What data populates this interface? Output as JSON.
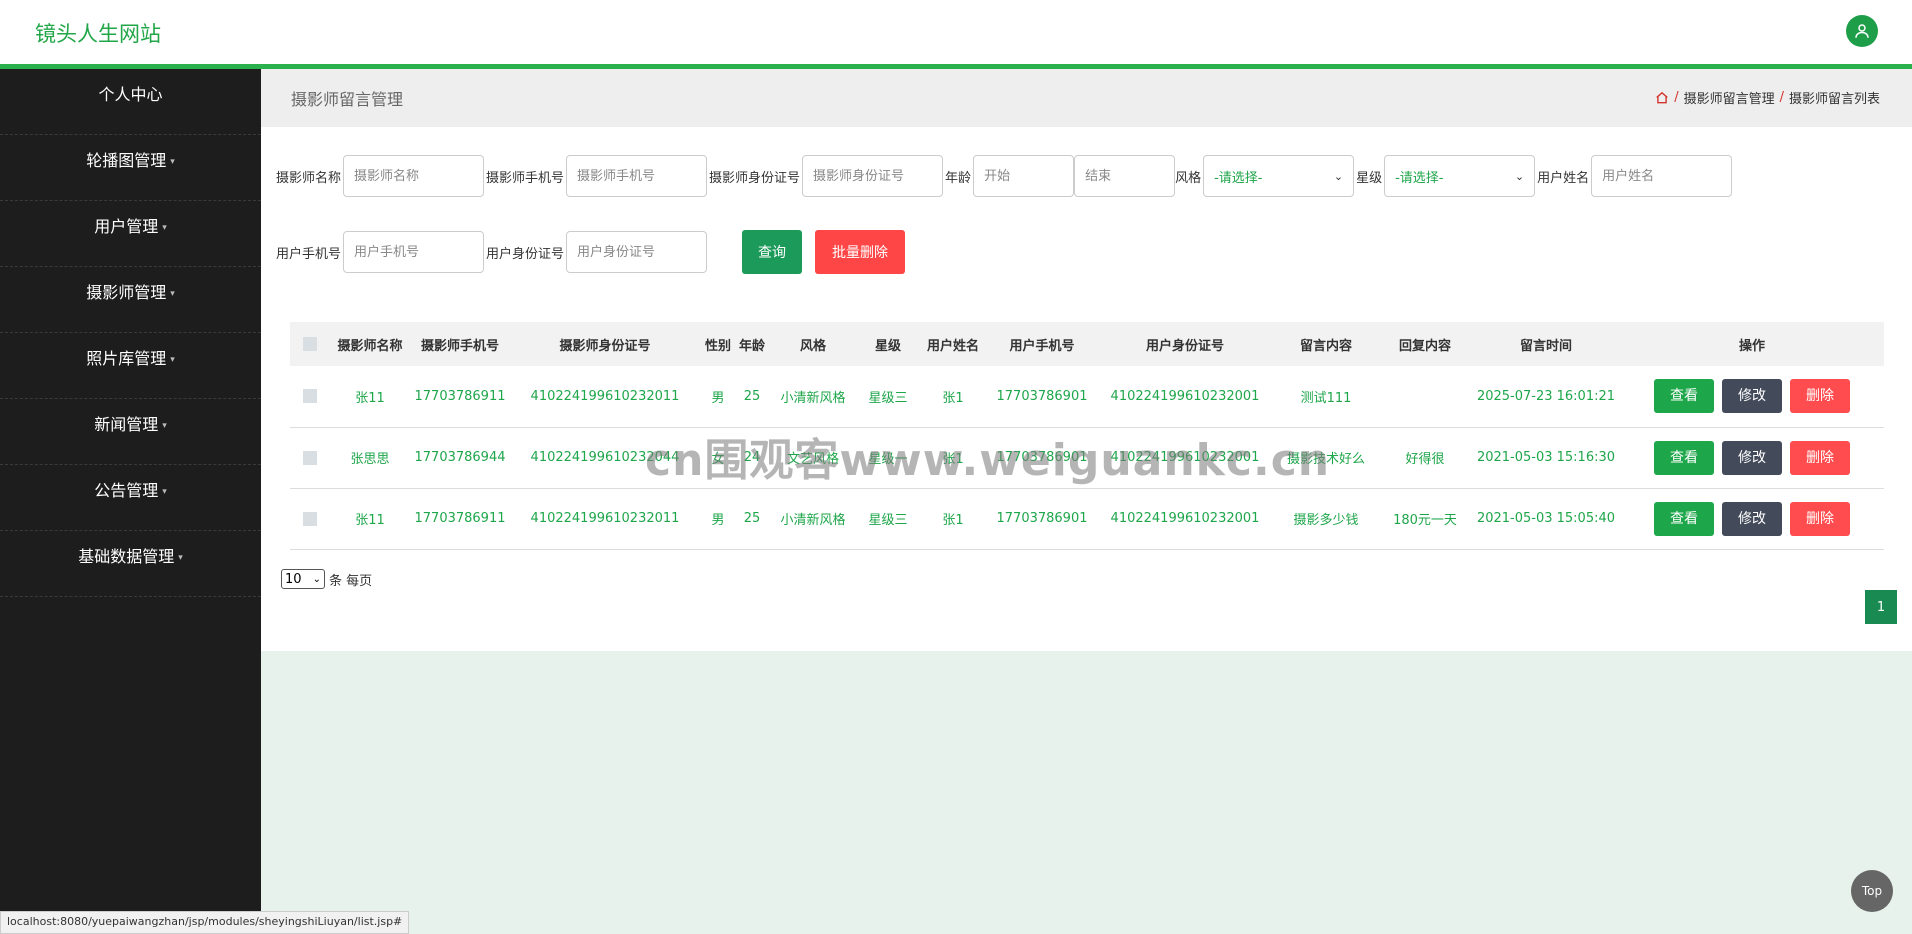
{
  "header": {
    "brand": "镜头人生网站",
    "user_icon": "user-icon"
  },
  "sidebar": {
    "items": [
      {
        "label": "个人中心",
        "caret": false
      },
      {
        "label": "轮播图管理",
        "caret": true
      },
      {
        "label": "用户管理",
        "caret": true
      },
      {
        "label": "摄影师管理",
        "caret": true
      },
      {
        "label": "照片库管理",
        "caret": true
      },
      {
        "label": "新闻管理",
        "caret": true
      },
      {
        "label": "公告管理",
        "caret": true
      },
      {
        "label": "基础数据管理",
        "caret": true
      }
    ]
  },
  "page": {
    "title": "摄影师留言管理",
    "breadcrumb": [
      "摄影师留言管理",
      "摄影师留言列表"
    ]
  },
  "search": {
    "photographer_name_label": "摄影师名称",
    "photographer_name_placeholder": "摄影师名称",
    "photographer_phone_label": "摄影师手机号",
    "photographer_phone_placeholder": "摄影师手机号",
    "photographer_id_label": "摄影师身份证号",
    "photographer_id_placeholder": "摄影师身份证号",
    "age_label": "年龄",
    "age_start_placeholder": "开始",
    "age_end_placeholder": "结束",
    "style_label": "风格",
    "style_value": "-请选择-",
    "level_label": "星级",
    "level_value": "-请选择-",
    "user_name_label": "用户姓名",
    "user_name_placeholder": "用户姓名",
    "user_phone_label": "用户手机号",
    "user_phone_placeholder": "用户手机号",
    "user_id_label": "用户身份证号",
    "user_id_placeholder": "用户身份证号",
    "query_button": "查询",
    "batch_delete_button": "批量删除"
  },
  "table": {
    "columns": [
      "摄影师名称",
      "摄影师手机号",
      "摄影师身份证号",
      "性别",
      "年龄",
      "风格",
      "星级",
      "用户姓名",
      "用户手机号",
      "用户身份证号",
      "留言内容",
      "回复内容",
      "留言时间",
      "操作"
    ],
    "rows": [
      [
        "张11",
        "17703786911",
        "410224199610232011",
        "男",
        "25",
        "小清新风格",
        "星级三",
        "张1",
        "17703786901",
        "410224199610232001",
        "测试111",
        "",
        "2025-07-23 16:01:21"
      ],
      [
        "张思思",
        "17703786944",
        "410224199610232044",
        "女",
        "24",
        "文艺风格",
        "星级一",
        "张1",
        "17703786901",
        "410224199610232001",
        "摄影技术好么",
        "好得很",
        "2021-05-03 15:16:30"
      ],
      [
        "张11",
        "17703786911",
        "410224199610232011",
        "男",
        "25",
        "小清新风格",
        "星级三",
        "张1",
        "17703786901",
        "410224199610232001",
        "摄影多少钱",
        "180元一天",
        "2021-05-03 15:05:40"
      ]
    ],
    "actions": {
      "view": "查看",
      "edit": "修改",
      "delete": "删除"
    }
  },
  "pagination": {
    "per_page_value": "10",
    "per_page_text": "条 每页",
    "current_page": "1"
  },
  "watermark": "cn围观客www.weiguankc.cn",
  "status_url": "localhost:8080/yuepaiwangzhan/jsp/modules/sheyingshiLiuyan/list.jsp#",
  "top_button": "Top",
  "colors": {
    "accent": "#2bb04e",
    "sidebar_bg": "#1d1d1d",
    "view": "#1ea64a",
    "edit": "#434a5a",
    "delete": "#ff4d4f",
    "batch_delete": "#ff4646",
    "query": "#1c9a5a"
  }
}
